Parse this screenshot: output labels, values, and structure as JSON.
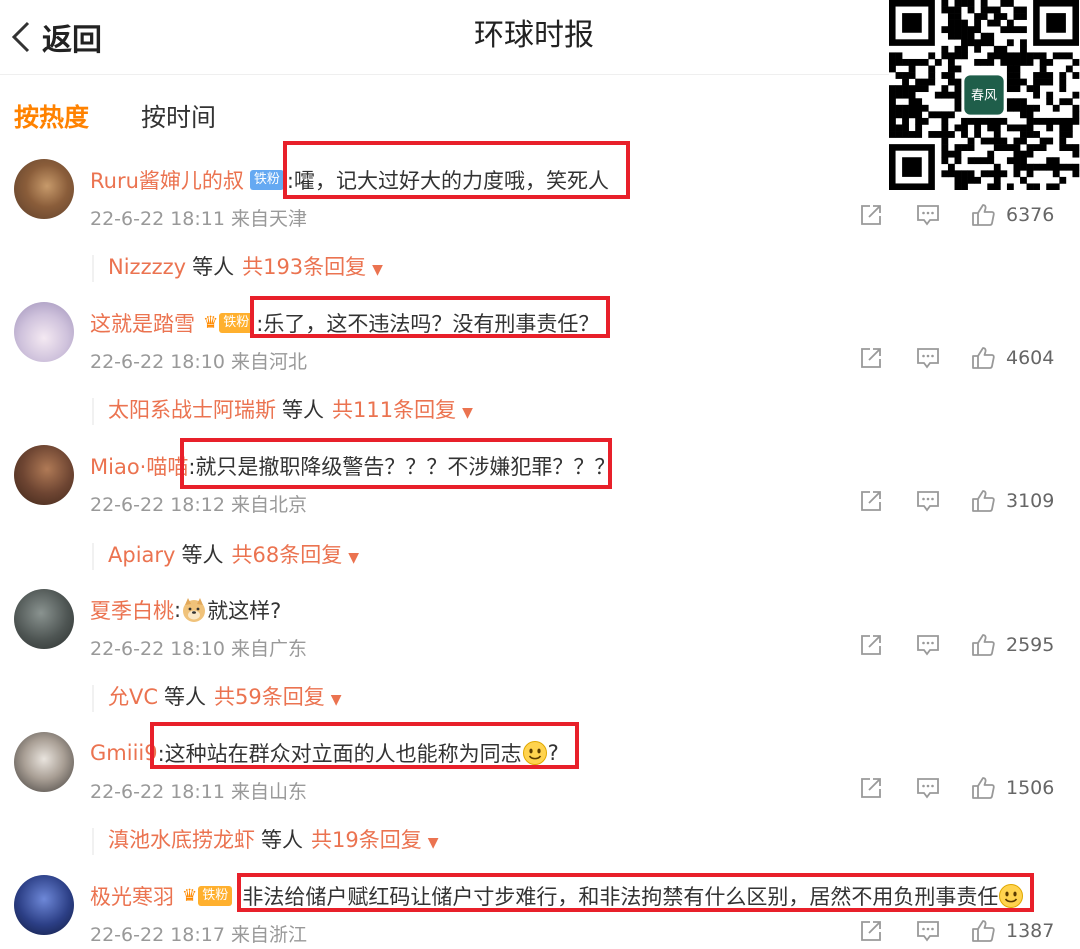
{
  "header": {
    "back_label": "返回",
    "title": "环球时报"
  },
  "sort_tabs": {
    "hot": "按热度",
    "time": "按时间"
  },
  "qr": {
    "caption": "春风"
  },
  "comments": [
    {
      "user": "Ruru酱婶儿的叔",
      "badge": "铁粉",
      "badge_type": "blue",
      "text": ":嚯，记大过好大的力度哦，笑死人",
      "time": "22-6-22 18:11 来自天津",
      "likes": "6376",
      "reply_user": "Nizzzzy",
      "reply_mid": "等人",
      "reply_count": "共193条回复"
    },
    {
      "user": "这就是踏雪",
      "badge": "铁粉",
      "badge_type": "orange",
      "text": ":乐了，这不违法吗？没有刑事责任？",
      "time": "22-6-22 18:10 来自河北",
      "likes": "4604",
      "reply_user": "太阳系战士阿瑞斯",
      "reply_mid": "等人",
      "reply_count": "共111条回复"
    },
    {
      "user": "Miao·喵喵",
      "badge": "",
      "text": ":就只是撤职降级警告？？？不涉嫌犯罪？？？",
      "time": "22-6-22 18:12 来自北京",
      "likes": "3109",
      "reply_user": "Apiary",
      "reply_mid": "等人",
      "reply_count": "共68条回复"
    },
    {
      "user": "夏季白桃",
      "badge": "",
      "text_pre": ":",
      "text": "就这样?",
      "time": "22-6-22 18:10 来自广东",
      "likes": "2595",
      "reply_user": "允VC",
      "reply_mid": "等人",
      "reply_count": "共59条回复"
    },
    {
      "user": "Gmiii9",
      "badge": "",
      "text": ":这种站在群众对立面的人也能称为同志",
      "text_post": "?",
      "time": "22-6-22 18:11 来自山东",
      "likes": "1506",
      "reply_user": "滇池水底捞龙虾",
      "reply_mid": "等人",
      "reply_count": "共19条回复"
    },
    {
      "user": "极光寒羽",
      "badge": "铁粉",
      "badge_type": "orange",
      "text": ":非法给储户赋红码让储户寸步难行，和非法拘禁有什么区别，居然不用负刑事责任",
      "time": "22-6-22 18:17 来自浙江",
      "likes": "1387"
    }
  ],
  "colors": {
    "accent": "#ff8200",
    "username": "#eb7350",
    "highlight_box": "#e8202a",
    "badge_blue": "#65a9f2",
    "badge_orange": "#ffb02e"
  },
  "icons": {
    "share": "share-icon",
    "comment": "comment-icon",
    "like": "thumbs-up-icon",
    "back": "chevron-left-icon",
    "expand": "caret-down-icon",
    "emoji": "smiley-emoji-icon"
  }
}
